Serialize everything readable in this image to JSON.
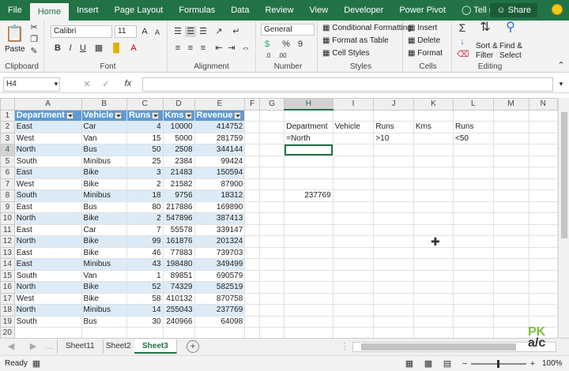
{
  "ribbon_tabs": [
    "File",
    "Home",
    "Insert",
    "Page Layout",
    "Formulas",
    "Data",
    "Review",
    "View",
    "Developer",
    "Power Pivot",
    "Tell me"
  ],
  "share_label": "Share",
  "clipboard": {
    "paste": "Paste",
    "label": "Clipboard"
  },
  "font": {
    "name": "Calibri",
    "size": "11",
    "label": "Font",
    "bold": "B",
    "italic": "I",
    "underline": "U"
  },
  "alignment": {
    "label": "Alignment"
  },
  "number": {
    "format": "General",
    "label": "Number",
    "currency": "$",
    "percent": "%",
    "comma": "9"
  },
  "styles": {
    "conditional": "Conditional Formatting",
    "table": "Format as Table",
    "cell": "Cell Styles",
    "label": "Styles"
  },
  "cells": {
    "insert": "Insert",
    "delete": "Delete",
    "format": "Format",
    "label": "Cells"
  },
  "editing": {
    "sort": "Sort &",
    "filter": "Filter",
    "find": "Find &",
    "select": "Select",
    "label": "Editing"
  },
  "namebox": "H4",
  "fx": "fx",
  "columns": [
    "A",
    "B",
    "C",
    "D",
    "E",
    "F",
    "G",
    "H",
    "I",
    "J",
    "K",
    "L",
    "M",
    "N"
  ],
  "active_col": "H",
  "active_row": "4",
  "table_headers": [
    "Department",
    "Vehicle",
    "Runs",
    "Kms",
    "Revenue"
  ],
  "rows": [
    [
      "East",
      "Car",
      "4",
      "10000",
      "414752"
    ],
    [
      "West",
      "Van",
      "15",
      "5000",
      "281759"
    ],
    [
      "North",
      "Bus",
      "50",
      "2508",
      "344144"
    ],
    [
      "South",
      "Minibus",
      "25",
      "2384",
      "99424"
    ],
    [
      "East",
      "Bike",
      "3",
      "21483",
      "150594"
    ],
    [
      "West",
      "Bike",
      "2",
      "21582",
      "87900"
    ],
    [
      "South",
      "Minibus",
      "18",
      "9756",
      "18312"
    ],
    [
      "East",
      "Bus",
      "80",
      "217886",
      "169890"
    ],
    [
      "North",
      "Bike",
      "2",
      "547896",
      "387413"
    ],
    [
      "East",
      "Car",
      "7",
      "55578",
      "339147"
    ],
    [
      "North",
      "Bike",
      "99",
      "161876",
      "201324"
    ],
    [
      "East",
      "Bike",
      "46",
      "77883",
      "739703"
    ],
    [
      "East",
      "Minibus",
      "43",
      "198480",
      "349499"
    ],
    [
      "South",
      "Van",
      "1",
      "89851",
      "690579"
    ],
    [
      "North",
      "Bike",
      "52",
      "74329",
      "582519"
    ],
    [
      "West",
      "Bike",
      "58",
      "410132",
      "870758"
    ],
    [
      "North",
      "Minibus",
      "14",
      "255043",
      "237769"
    ],
    [
      "South",
      "Bus",
      "30",
      "240966",
      "64098"
    ]
  ],
  "criteria": {
    "headers": [
      "Department",
      "Vehicle",
      "Runs",
      "Kms",
      "Runs"
    ],
    "values": [
      "=North",
      "",
      ">10",
      "",
      "<50"
    ]
  },
  "result_h8": "237769",
  "sheets": [
    "Sheet11",
    "Sheet2",
    "Sheet3"
  ],
  "active_sheet": "Sheet3",
  "status": {
    "ready": "Ready",
    "zoom": "100%"
  },
  "watermark": "PK a/c"
}
